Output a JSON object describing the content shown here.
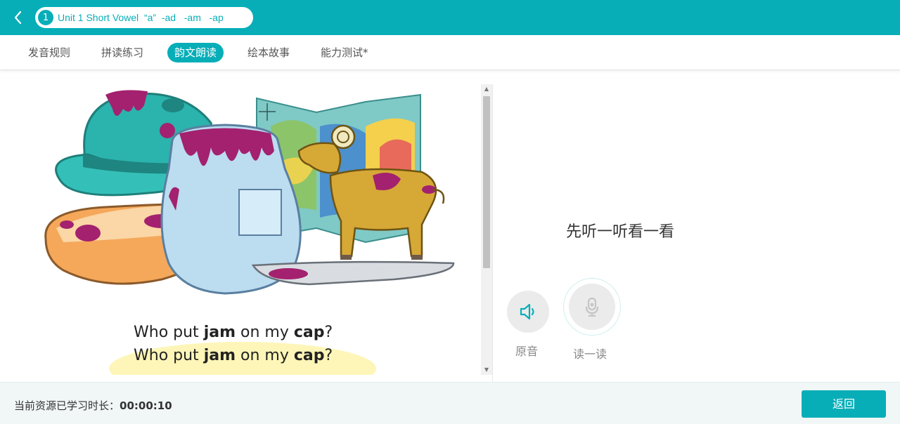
{
  "header": {
    "unit_number": "1",
    "unit_title": "Unit 1 Short Vowel  “a”  -ad   -am   -ap",
    "back_icon": "chevron-left-icon"
  },
  "tabs": [
    {
      "label": "发音规则",
      "active": false
    },
    {
      "label": "拼读练习",
      "active": false
    },
    {
      "label": "韵文朗读",
      "active": true
    },
    {
      "label": "绘本故事",
      "active": false
    },
    {
      "label": "能力测试*",
      "active": false
    }
  ],
  "verse": {
    "lines": [
      {
        "pre": "Who put ",
        "word1": "jam",
        "mid": " on my ",
        "word2": "cap",
        "post": "?"
      },
      {
        "pre": "Who put ",
        "word1": "jam",
        "mid": " on my ",
        "word2": "cap",
        "post": "?"
      }
    ]
  },
  "right_panel": {
    "prompt": "先听一听看一看",
    "original_audio_label": "原音",
    "read_aloud_label": "读一读"
  },
  "footer": {
    "timer_label": "当前资源已学习时长：",
    "timer_value": "00:00:10",
    "return_label": "返回"
  },
  "colors": {
    "accent": "#07aeb8",
    "jam": "#a3216e",
    "cap": "#2bb3ad",
    "jar": "#bcdcf0",
    "bread": "#f5a85a",
    "goat": "#d6a836"
  }
}
